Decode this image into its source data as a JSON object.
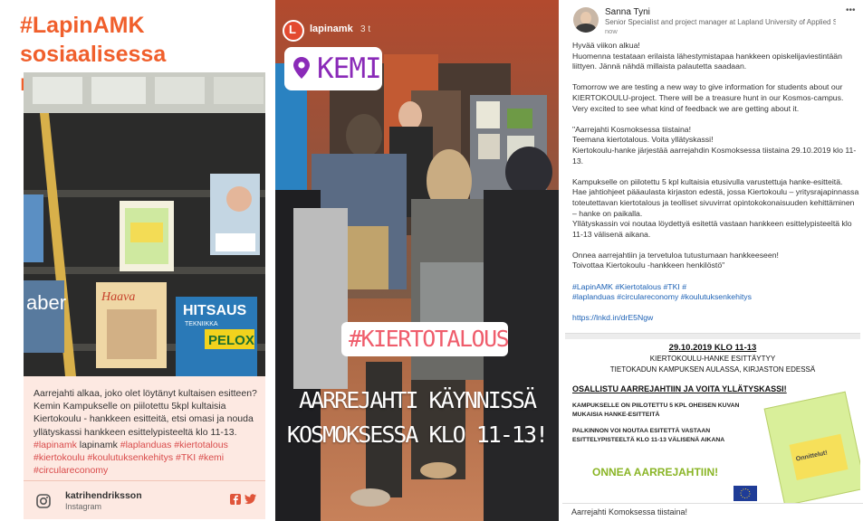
{
  "panel1": {
    "title_line1": "#LapinAMK sosiaalisessa",
    "title_line2": "mediassa",
    "caption_text": "Aarrejahti alkaa, joko olet löytänyt kultaisen esitteen? Kemin Kampukselle on piilotettu 5kpl kultaisia Kiertokoulu - hankkeen esitteitä, etsi omasi ja nouda yllätyskassi hankkeen esittelypisteeltä klo 11-13. ",
    "caption_tag1": "#lapinamk",
    "caption_mention": " lapinamk ",
    "caption_tags2": "#laplanduas #kiertotalous #kiertokoulu #koulutuksenkehitys #TKI #kemi #circulareconomy",
    "magazine1": "Haava",
    "magazine2": "HITSAUS",
    "magazine2_sub": "TEKNIIKKA",
    "magazine3": "PELOX",
    "magazine_left": "aber",
    "username": "katrihendriksson",
    "platform": "Instagram",
    "colors": {
      "accent": "#f05f2c",
      "card": "#fde9e2"
    }
  },
  "panel2": {
    "username": "lapinamk",
    "time": "3 t",
    "location": "KEMI",
    "hashtag": "#KIERTOTALOUS",
    "overlay_line1": "AARREJAHTI KÄYNNISSÄ",
    "overlay_line2": "KOSMOKSESSA KLO 11-13!"
  },
  "panel3": {
    "name": "Sanna Tyni",
    "subtitle": "Senior Specialist and project manager at Lapland University of Applied Science...",
    "time": "now",
    "menu": "•••",
    "para1": "Hyvää viikon alkua!\nHuomenna testataan erilaista lähestymistapaa hankkeen opiskelijaviestintään liittyen. Jännä nähdä millaista palautetta saadaan.",
    "para2": "Tomorrow we are testing a new way to give information for students about our KIERTOKOULU-project. There will be a treasure hunt in our Kosmos-campus. Very excited to see what kind of feedback we are getting about it.",
    "para3": "\"Aarrejahti Kosmoksessa tiistaina!\nTeemana kiertotalous. Voita yllätyskassi!\nKiertokoulu-hanke järjestää aarrejahdin Kosmoksessa tiistaina 29.10.2019 klo 11-13.",
    "para4": "Kampukselle on piilotettu 5 kpl kultaisia etusivulla varustettuja hanke-esitteitä.\nHae jahtiohjeet pääaulasta kirjaston edestä, jossa Kiertokoulu – yritysrajapinnassa toteutettavan kiertotalous ja teolliset sivuvirrat opintokokonaisuuden kehittäminen – hanke on paikalla.\nYllätyskassin voi noutaa löydettyä esitettä vastaan hankkeen esittelypisteeltä klo 11-13 välisenä aikana.",
    "para5": "Onnea aarrejahtiin ja tervetuloa tutustumaan hankkeeseen!\nToivottaa Kiertokoulu -hankkeen henkilöstö\"",
    "tags1": "#LapinAMK #Kiertotalous #TKI #",
    "tags2": "#laplanduas #circulareconomy #koulutuksenkehitys",
    "link": "https://lnkd.in/drE5Ngw",
    "poster_date": "29.10.2019 KLO 11-13",
    "poster_line1": "KIERTOKOULU-HANKE ESITTÄYTYY",
    "poster_line2": "TIETOKADUN KAMPUKSEN AULASSA, KIRJASTON EDESSÄ",
    "poster_heading": "OSALLISTU AARREJAHTIIN JA VOITA YLLÄTYSKASSI!",
    "poster_body1": "KAMPUKSELLE ON PIILOTETTU 5 KPL OHEISEN KUVAN",
    "poster_body2": "MUKAISIA HANKE-ESITTEITÄ",
    "poster_body3": "PALKINNON VOI NOUTAA ESITETTÄ VASTAAN",
    "poster_body4": "ESITTELYPISTEELTÄ KLO 11-13 VÄLISENÄ AIKANA",
    "poster_luck": "ONNEA AARREJAHTIIN!",
    "poster_flyer_word": "Onnittelut!",
    "bottom_caption": "Aarrejahti Komoksessa tiistaina!"
  }
}
